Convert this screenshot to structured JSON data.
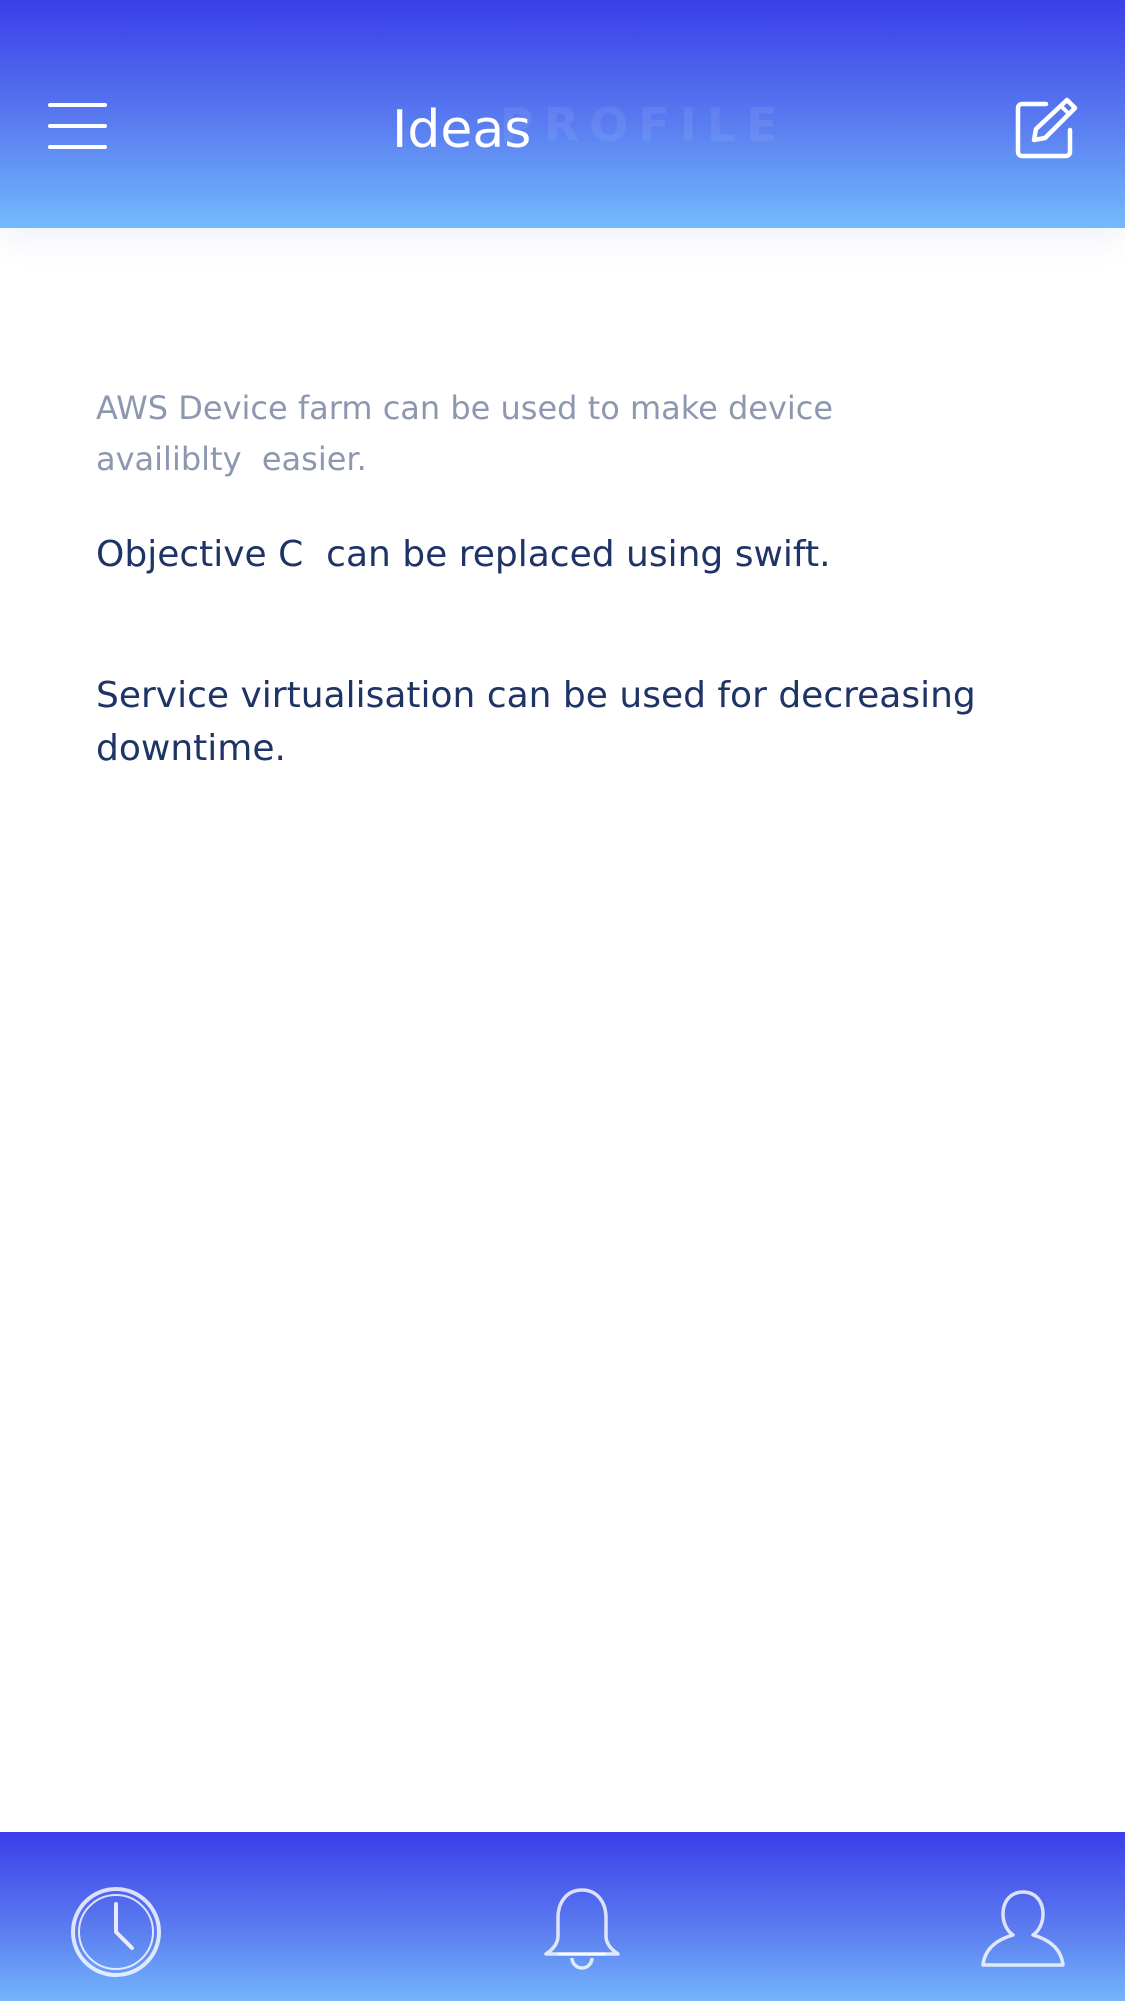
{
  "header": {
    "title": "Ideas",
    "ghost_title": "PROFILE",
    "menu_icon": "hamburger-menu-icon",
    "compose_icon": "compose-edit-icon"
  },
  "ideas": [
    {
      "text": "AWS Device farm can be used to make device availiblty  easier."
    },
    {
      "text": "Objective C  can be replaced using swift."
    },
    {
      "text": "Service virtualisation can be used for decreasing downtime."
    }
  ],
  "tabbar": {
    "items": [
      {
        "icon": "clock-icon"
      },
      {
        "icon": "bell-icon"
      },
      {
        "icon": "user-icon"
      }
    ]
  },
  "colors": {
    "header_gradient_top": "#3a3ee9",
    "header_gradient_bottom": "#72bbfc",
    "idea_text": "#1f3466",
    "idea_text_muted": "#8d98b0"
  }
}
